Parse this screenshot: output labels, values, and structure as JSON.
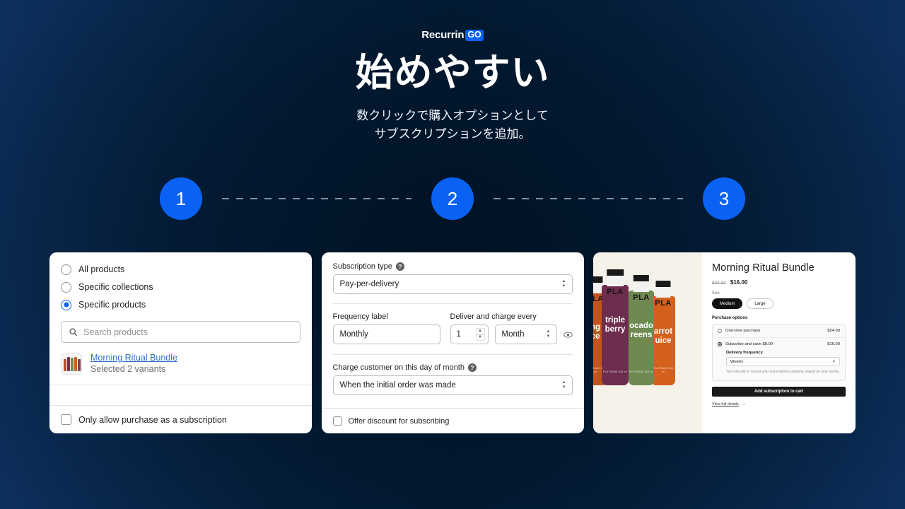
{
  "brand": {
    "name": "Recurrin",
    "badge": "GO",
    "accent": "#0a62f5"
  },
  "hero": {
    "headline": "始めやすい",
    "subtitle_line1": "数クリックで購入オプションとして",
    "subtitle_line2": "サブスクリプションを追加。"
  },
  "steps": [
    {
      "number": "1"
    },
    {
      "number": "2"
    },
    {
      "number": "3"
    }
  ],
  "card1": {
    "radio_options": [
      {
        "label": "All products",
        "selected": false
      },
      {
        "label": "Specific collections",
        "selected": false
      },
      {
        "label": "Specific products",
        "selected": true
      }
    ],
    "search": {
      "icon": "search-icon",
      "placeholder": "Search products"
    },
    "product": {
      "title": "Morning Ritual Bundle",
      "subtitle": "Selected 2 variants"
    },
    "footer_checkbox": {
      "label": "Only allow purchase as a subscription",
      "checked": false
    }
  },
  "card2": {
    "subscription_type": {
      "label": "Subscription type",
      "help": "?",
      "value": "Pay-per-delivery"
    },
    "frequency_label": {
      "label": "Frequency label",
      "value": "Monthly"
    },
    "deliver_charge": {
      "label": "Deliver and charge every",
      "interval_count": "1",
      "interval_unit": "Month"
    },
    "charge_day": {
      "label": "Charge customer on this day of month",
      "help": "?",
      "value": "When the initial order was made"
    },
    "footer_checkbox": {
      "label": "Offer discount for subscribing",
      "checked": false
    }
  },
  "card3": {
    "image": {
      "bottles": [
        {
          "flavor_line1": "ng",
          "flavor_line2": "ce",
          "brand": "PLA",
          "color": "#d4641e"
        },
        {
          "flavor_line1": "triple",
          "flavor_line2": "berry",
          "brand": "PLA",
          "color": "#6d2d4e"
        },
        {
          "flavor_line1": "ocado",
          "flavor_line2": "reens",
          "brand": "PLA",
          "color": "#6f8a51"
        },
        {
          "flavor_line1": "arrot",
          "flavor_line2": "uice",
          "brand": "PLA",
          "color": "#d4601b"
        }
      ],
      "tiny_text": "PLATINUM 330 ml"
    },
    "title": "Morning Ritual Bundle",
    "price_old": "$24.00",
    "price_new": "$16.00",
    "size_label": "Size",
    "size_options": [
      {
        "label": "Medium",
        "selected": true
      },
      {
        "label": "Large",
        "selected": false
      }
    ],
    "purchase_options_label": "Purchase options",
    "options": [
      {
        "label": "One-time purchase",
        "price": "$24.00",
        "selected": false
      },
      {
        "label": "Subscribe and save $8.00",
        "price": "$16.00",
        "selected": true
      }
    ],
    "delivery_frequency_label": "Delivery frequency",
    "delivery_frequency_value": "Weekly",
    "note": "You can edit or cancel your subscriptions anytime, based on your needs.",
    "cart_button": "Add subscription to cart",
    "view_full_details": "View full details",
    "view_full_arrow": "→"
  }
}
